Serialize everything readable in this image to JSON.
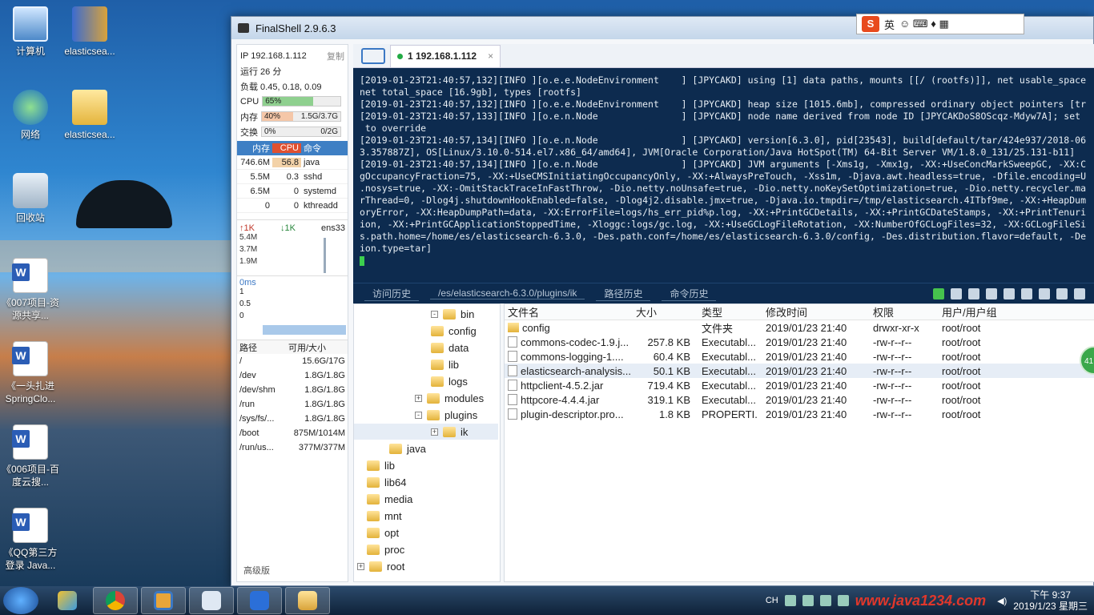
{
  "desktop": {
    "icons": [
      "计算机",
      "elasticsea...",
      "网络",
      "elasticsea...",
      "回收站",
      "《007项目-资源共享...",
      "《一头扎进SpringClo...",
      "《006项目-百度云搜...",
      "《QQ第三方登录 Java..."
    ]
  },
  "window": {
    "title": "FinalShell 2.9.6.3"
  },
  "ime": {
    "label": "英"
  },
  "sysinfo": {
    "ip_label": "IP 192.168.1.112",
    "copy_label": "复制",
    "uptime": "运行 26 分",
    "load": "负载 0.45, 0.18, 0.09",
    "cpu_label": "CPU",
    "cpu_value": "65%",
    "cpu_fraction": 0.65,
    "mem_label": "内存",
    "mem_pct": "40%",
    "mem_value": "1.5G/3.7G",
    "mem_fraction": 0.4,
    "swap_label": "交换",
    "swap_pct": "0%",
    "swap_value": "0/2G",
    "proc_headers": [
      "内存",
      "CPU",
      "命令"
    ],
    "procs": [
      {
        "mem": "746.6M",
        "cpu": "56.8",
        "cmd": "java"
      },
      {
        "mem": "5.5M",
        "cpu": "0.3",
        "cmd": "sshd"
      },
      {
        "mem": "6.5M",
        "cpu": "0",
        "cmd": "systemd"
      },
      {
        "mem": "0",
        "cpu": "0",
        "cmd": "kthreadd"
      }
    ],
    "net_up": "↑1K",
    "net_down": "↓1K",
    "net_iface": "ens33",
    "net_scale": [
      "5.4M",
      "3.7M",
      "1.9M"
    ],
    "ping_label": "0ms",
    "ping_scale": [
      "1",
      "0.5",
      "0"
    ],
    "disk_headers": [
      "路径",
      "可用/大小"
    ],
    "disks": [
      {
        "path": "/",
        "val": "15.6G/17G"
      },
      {
        "path": "/dev",
        "val": "1.8G/1.8G"
      },
      {
        "path": "/dev/shm",
        "val": "1.8G/1.8G"
      },
      {
        "path": "/run",
        "val": "1.8G/1.8G"
      },
      {
        "path": "/sys/fs/...",
        "val": "1.8G/1.8G"
      },
      {
        "path": "/boot",
        "val": "875M/1014M"
      },
      {
        "path": "/run/us...",
        "val": "377M/377M"
      }
    ],
    "advanced": "高级版"
  },
  "tab": {
    "label": "1 192.168.1.112",
    "close": "×"
  },
  "terminal": {
    "lines": [
      "[2019-01-23T21:40:57,132][INFO ][o.e.e.NodeEnvironment    ] [JPYCAKD] using [1] data paths, mounts [[/ (rootfs)]], net usable_space",
      "net total_space [16.9gb], types [rootfs]",
      "[2019-01-23T21:40:57,132][INFO ][o.e.e.NodeEnvironment    ] [JPYCAKD] heap size [1015.6mb], compressed ordinary object pointers [tr",
      "[2019-01-23T21:40:57,133][INFO ][o.e.n.Node               ] [JPYCAKD] node name derived from node ID [JPYCAKDoS8OScqz-Mdyw7A]; set",
      " to override",
      "[2019-01-23T21:40:57,134][INFO ][o.e.n.Node               ] [JPYCAKD] version[6.3.0], pid[23543], build[default/tar/424e937/2018-06",
      "3.357887Z], OS[Linux/3.10.0-514.el7.x86_64/amd64], JVM[Oracle Corporation/Java HotSpot(TM) 64-Bit Server VM/1.8.0_131/25.131-b11]",
      "[2019-01-23T21:40:57,134][INFO ][o.e.n.Node               ] [JPYCAKD] JVM arguments [-Xms1g, -Xmx1g, -XX:+UseConcMarkSweepGC, -XX:C",
      "gOccupancyFraction=75, -XX:+UseCMSInitiatingOccupancyOnly, -XX:+AlwaysPreTouch, -Xss1m, -Djava.awt.headless=true, -Dfile.encoding=U",
      ".nosys=true, -XX:-OmitStackTraceInFastThrow, -Dio.netty.noUnsafe=true, -Dio.netty.noKeySetOptimization=true, -Dio.netty.recycler.ma",
      "rThread=0, -Dlog4j.shutdownHookEnabled=false, -Dlog4j2.disable.jmx=true, -Djava.io.tmpdir=/tmp/elasticsearch.4ITbf9me, -XX:+HeapDum",
      "oryError, -XX:HeapDumpPath=data, -XX:ErrorFile=logs/hs_err_pid%p.log, -XX:+PrintGCDetails, -XX:+PrintGCDateStamps, -XX:+PrintTenuri",
      "ion, -XX:+PrintGCApplicationStoppedTime, -Xloggc:logs/gc.log, -XX:+UseGCLogFileRotation, -XX:NumberOfGCLogFiles=32, -XX:GCLogFileSi",
      "s.path.home=/home/es/elasticsearch-6.3.0, -Des.path.conf=/home/es/elasticsearch-6.3.0/config, -Des.distribution.flavor=default, -De",
      "ion.type=tar]"
    ]
  },
  "toolbar": {
    "history": "访问历史",
    "path": "/es/elasticsearch-6.3.0/plugins/ik",
    "path_history": "路径历史",
    "cmd_history": "命令历史"
  },
  "tree": [
    "bin",
    "config",
    "data",
    "lib",
    "logs",
    "modules",
    "plugins",
    "ik",
    "java",
    "lib",
    "lib64",
    "media",
    "mnt",
    "opt",
    "proc",
    "root"
  ],
  "files": {
    "headers": [
      "文件名",
      "大小",
      "类型",
      "修改时间",
      "权限",
      "用户/用户组"
    ],
    "rows": [
      {
        "name": "config",
        "size": "",
        "type": "文件夹",
        "time": "2019/01/23 21:40",
        "perm": "drwxr-xr-x",
        "owner": "root/root",
        "dir": true
      },
      {
        "name": "commons-codec-1.9.j...",
        "size": "257.8 KB",
        "type": "Executabl...",
        "time": "2019/01/23 21:40",
        "perm": "-rw-r--r--",
        "owner": "root/root"
      },
      {
        "name": "commons-logging-1....",
        "size": "60.4 KB",
        "type": "Executabl...",
        "time": "2019/01/23 21:40",
        "perm": "-rw-r--r--",
        "owner": "root/root"
      },
      {
        "name": "elasticsearch-analysis...",
        "size": "50.1 KB",
        "type": "Executabl...",
        "time": "2019/01/23 21:40",
        "perm": "-rw-r--r--",
        "owner": "root/root"
      },
      {
        "name": "httpclient-4.5.2.jar",
        "size": "719.4 KB",
        "type": "Executabl...",
        "time": "2019/01/23 21:40",
        "perm": "-rw-r--r--",
        "owner": "root/root"
      },
      {
        "name": "httpcore-4.4.4.jar",
        "size": "319.1 KB",
        "type": "Executabl...",
        "time": "2019/01/23 21:40",
        "perm": "-rw-r--r--",
        "owner": "root/root"
      },
      {
        "name": "plugin-descriptor.pro...",
        "size": "1.8 KB",
        "type": "PROPERTI...",
        "time": "2019/01/23 21:40",
        "perm": "-rw-r--r--",
        "owner": "root/root"
      }
    ]
  },
  "badge": "41",
  "taskbar": {
    "lang": "CH",
    "watermark": "www.java1234.com",
    "time": "下午 9:37",
    "date": "2019/1/23 星期三"
  },
  "colors": {
    "cpu_fill": "#8fd08f",
    "mem_fill": "#f5c7a8",
    "terminal_bg": "#0d2b4f"
  }
}
